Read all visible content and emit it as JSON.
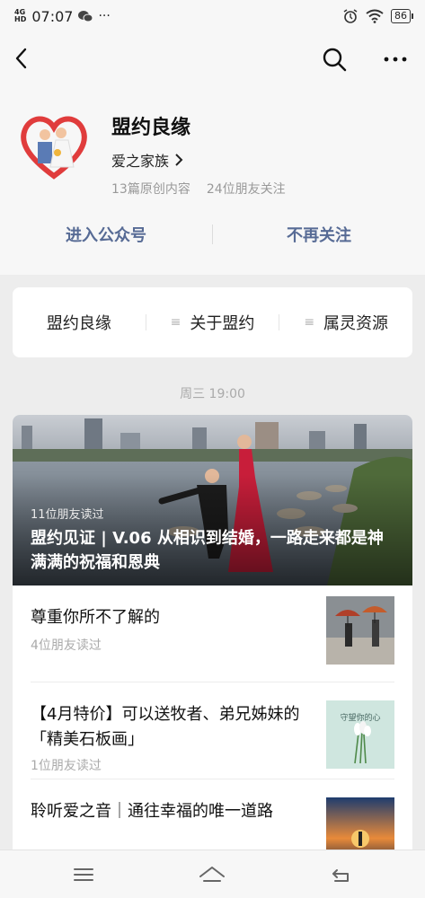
{
  "status_bar": {
    "network_top": "4G",
    "network_sub": "HD",
    "time": "07:07",
    "notif_icons": [
      "wechat-icon",
      "more-dots-icon"
    ],
    "right_icons": [
      "alarm-icon",
      "wifi-icon"
    ],
    "battery": "86"
  },
  "account": {
    "name": "盟约良缘",
    "org": "爱之家族",
    "articles_count": "13篇原创内容",
    "friends_follow": "24位朋友关注",
    "enter_label": "进入公众号",
    "unfollow_label": "不再关注"
  },
  "menu": {
    "items": [
      {
        "label": "盟约良缘"
      },
      {
        "label": "关于盟约"
      },
      {
        "label": "属灵资源"
      }
    ]
  },
  "feed": {
    "datetime": "周三 19:00",
    "hero": {
      "readers": "11位朋友读过",
      "title": "盟约见证 | V.06 从相识到结婚，一路走来都是神满满的祝福和恩典"
    },
    "articles": [
      {
        "title": "尊重你所不了解的",
        "readers": "4位朋友读过"
      },
      {
        "title": "【4月特价】可以送牧者、弟兄姊妹的「精美石板画」",
        "readers": "1位朋友读过",
        "thumb_text": "守望你的心"
      },
      {
        "title": "聆听爱之音｜通往幸福的唯一道路",
        "readers": ""
      }
    ]
  },
  "colors": {
    "link_blue": "#576b95",
    "background": "#ededed",
    "heart_red": "#e03c3c"
  }
}
